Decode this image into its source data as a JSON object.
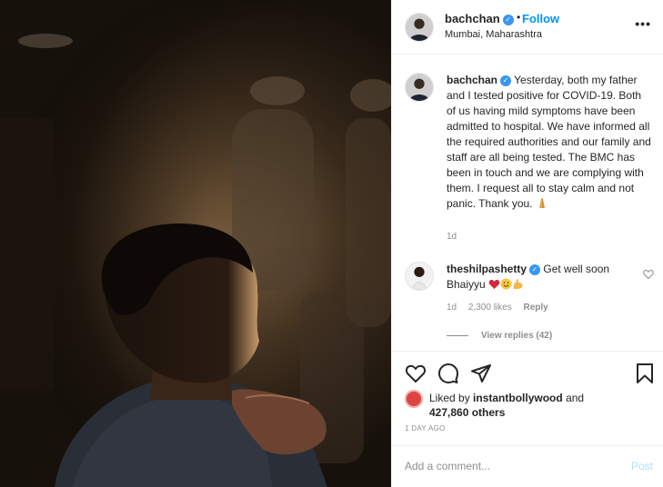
{
  "header": {
    "username": "bachchan",
    "dot": "•",
    "follow_label": "Follow",
    "location": "Mumbai, Maharashtra",
    "more_label": "•••"
  },
  "caption": {
    "username": "bachchan",
    "text": "Yesterday, both my father and I tested positive for COVID-19. Both of us having mild symptoms have been admitted to hospital. We have informed all the required authorities and our family and staff are all being tested. The BMC has been in touch and we are complying with them. I request all to stay calm and not panic. Thank you.",
    "emoji_icon": "folded-hands-icon",
    "time": "1d"
  },
  "comment": {
    "username": "theshilpashetty",
    "text": "Get well soon Bhaiyyu",
    "emoji_icons": [
      "red-heart-icon",
      "smiling-face-icon",
      "flexed-biceps-icon"
    ],
    "time": "1d",
    "likes": "2,300 likes",
    "reply_label": "Reply",
    "view_replies": "View replies (42)"
  },
  "actions": {
    "like_icon": "heart-outline-icon",
    "comment_icon": "comment-icon",
    "share_icon": "paper-plane-icon",
    "save_icon": "bookmark-icon"
  },
  "likes": {
    "prefix": "Liked by",
    "user": "instantbollywood",
    "and": "and",
    "others": "427,860 others"
  },
  "date": "1 DAY AGO",
  "comment_box": {
    "placeholder": "Add a comment...",
    "post_label": "Post"
  },
  "colors": {
    "accent": "#0095f6",
    "verified": "#3897f0",
    "muted": "#8e8e8e",
    "post_disabled": "#b2dffc"
  }
}
